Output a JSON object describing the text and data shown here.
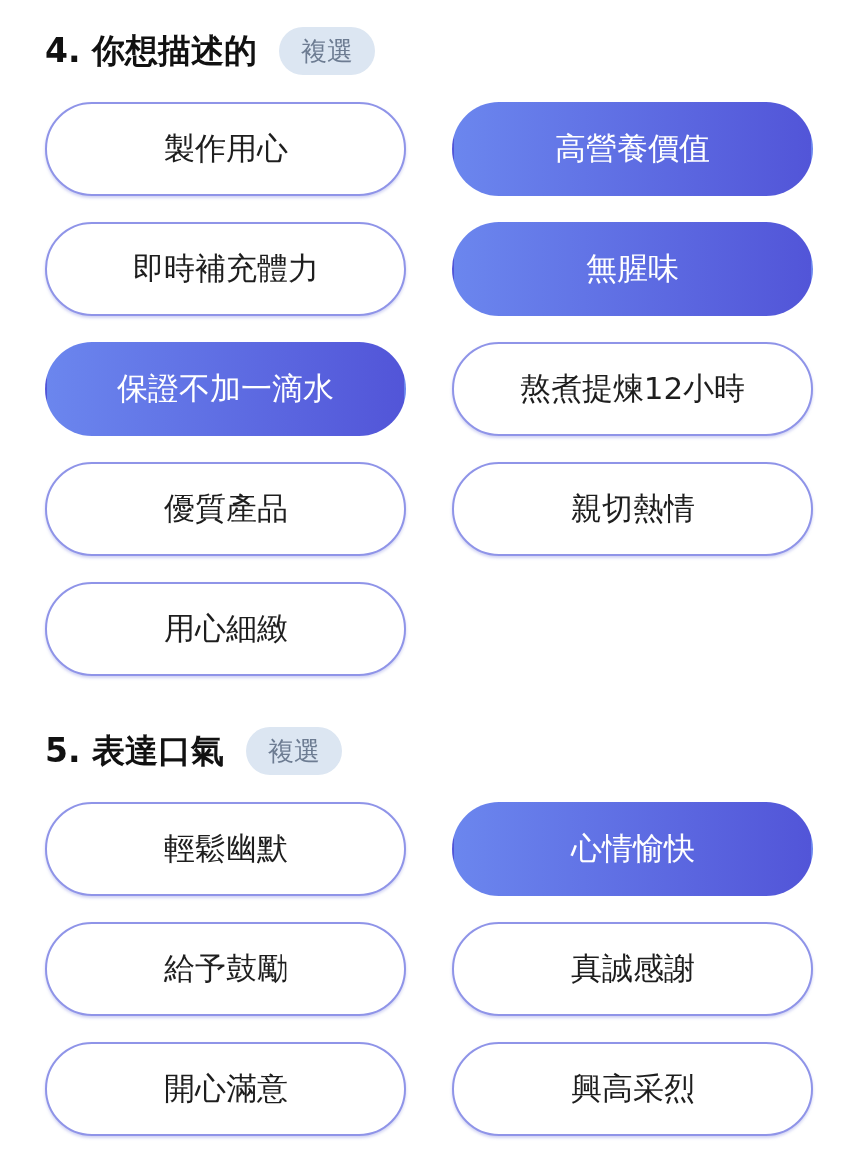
{
  "sections": [
    {
      "title": "4. 你想描述的",
      "badge": "複選",
      "options": [
        {
          "label": "製作用心",
          "selected": false
        },
        {
          "label": "高營養價值",
          "selected": true
        },
        {
          "label": "即時補充體力",
          "selected": false
        },
        {
          "label": "無腥味",
          "selected": true
        },
        {
          "label": "保證不加一滴水",
          "selected": true
        },
        {
          "label": "熬煮提煉12小時",
          "selected": false
        },
        {
          "label": "優質產品",
          "selected": false
        },
        {
          "label": "親切熱情",
          "selected": false
        },
        {
          "label": "用心細緻",
          "selected": false
        }
      ]
    },
    {
      "title": "5. 表達口氣",
      "badge": "複選",
      "options": [
        {
          "label": "輕鬆幽默",
          "selected": false
        },
        {
          "label": "心情愉快",
          "selected": true
        },
        {
          "label": "給予鼓勵",
          "selected": false
        },
        {
          "label": "真誠感謝",
          "selected": false
        },
        {
          "label": "開心滿意",
          "selected": false
        },
        {
          "label": "興高采烈",
          "selected": false
        }
      ]
    }
  ]
}
